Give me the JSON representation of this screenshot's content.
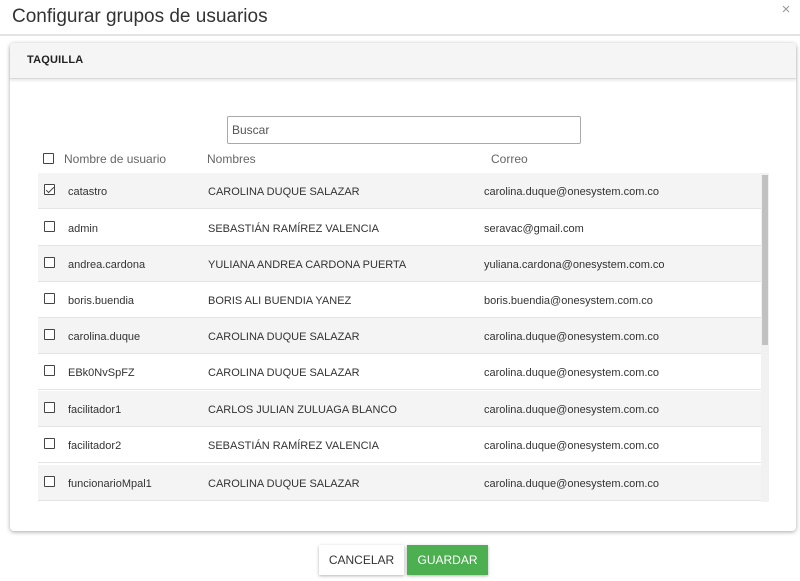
{
  "modal": {
    "title": "Configurar grupos de usuarios",
    "close_icon": "×"
  },
  "card": {
    "title": "TAQUILLA"
  },
  "search": {
    "placeholder": "Buscar",
    "value": ""
  },
  "table": {
    "columns": [
      "Nombre de usuario",
      "Nombres",
      "Correo"
    ],
    "rows": [
      {
        "checked": true,
        "user": "catastro",
        "name": "CAROLINA DUQUE SALAZAR",
        "email": "carolina.duque@onesystem.com.co"
      },
      {
        "checked": false,
        "user": "admin",
        "name": "SEBASTIÁN RAMÍREZ VALENCIA",
        "email": "seravac@gmail.com"
      },
      {
        "checked": false,
        "user": "andrea.cardona",
        "name": "YULIANA ANDREA CARDONA PUERTA",
        "email": "yuliana.cardona@onesystem.com.co"
      },
      {
        "checked": false,
        "user": "boris.buendia",
        "name": "BORIS ALI BUENDIA YANEZ",
        "email": "boris.buendia@onesystem.com.co"
      },
      {
        "checked": false,
        "user": "carolina.duque",
        "name": "CAROLINA DUQUE SALAZAR",
        "email": "carolina.duque@onesystem.com.co"
      },
      {
        "checked": false,
        "user": "EBk0NvSpFZ",
        "name": "CAROLINA DUQUE SALAZAR",
        "email": "carolina.duque@onesystem.com.co"
      },
      {
        "checked": false,
        "user": "facilitador1",
        "name": "CARLOS JULIAN ZULUAGA BLANCO",
        "email": "carolina.duque@onesystem.com.co"
      },
      {
        "checked": false,
        "user": "facilitador2",
        "name": "SEBASTIÁN RAMÍREZ VALENCIA",
        "email": "carolina.duque@onesystem.com.co"
      },
      {
        "checked": false,
        "user": "funcionarioMpal1",
        "name": "CAROLINA DUQUE SALAZAR",
        "email": "carolina.duque@onesystem.com.co"
      }
    ]
  },
  "footer": {
    "cancel_label": "CANCELAR",
    "save_label": "GUARDAR"
  },
  "colors": {
    "save_button": "#4caf50",
    "row_stripe": "#f4f4f4"
  }
}
